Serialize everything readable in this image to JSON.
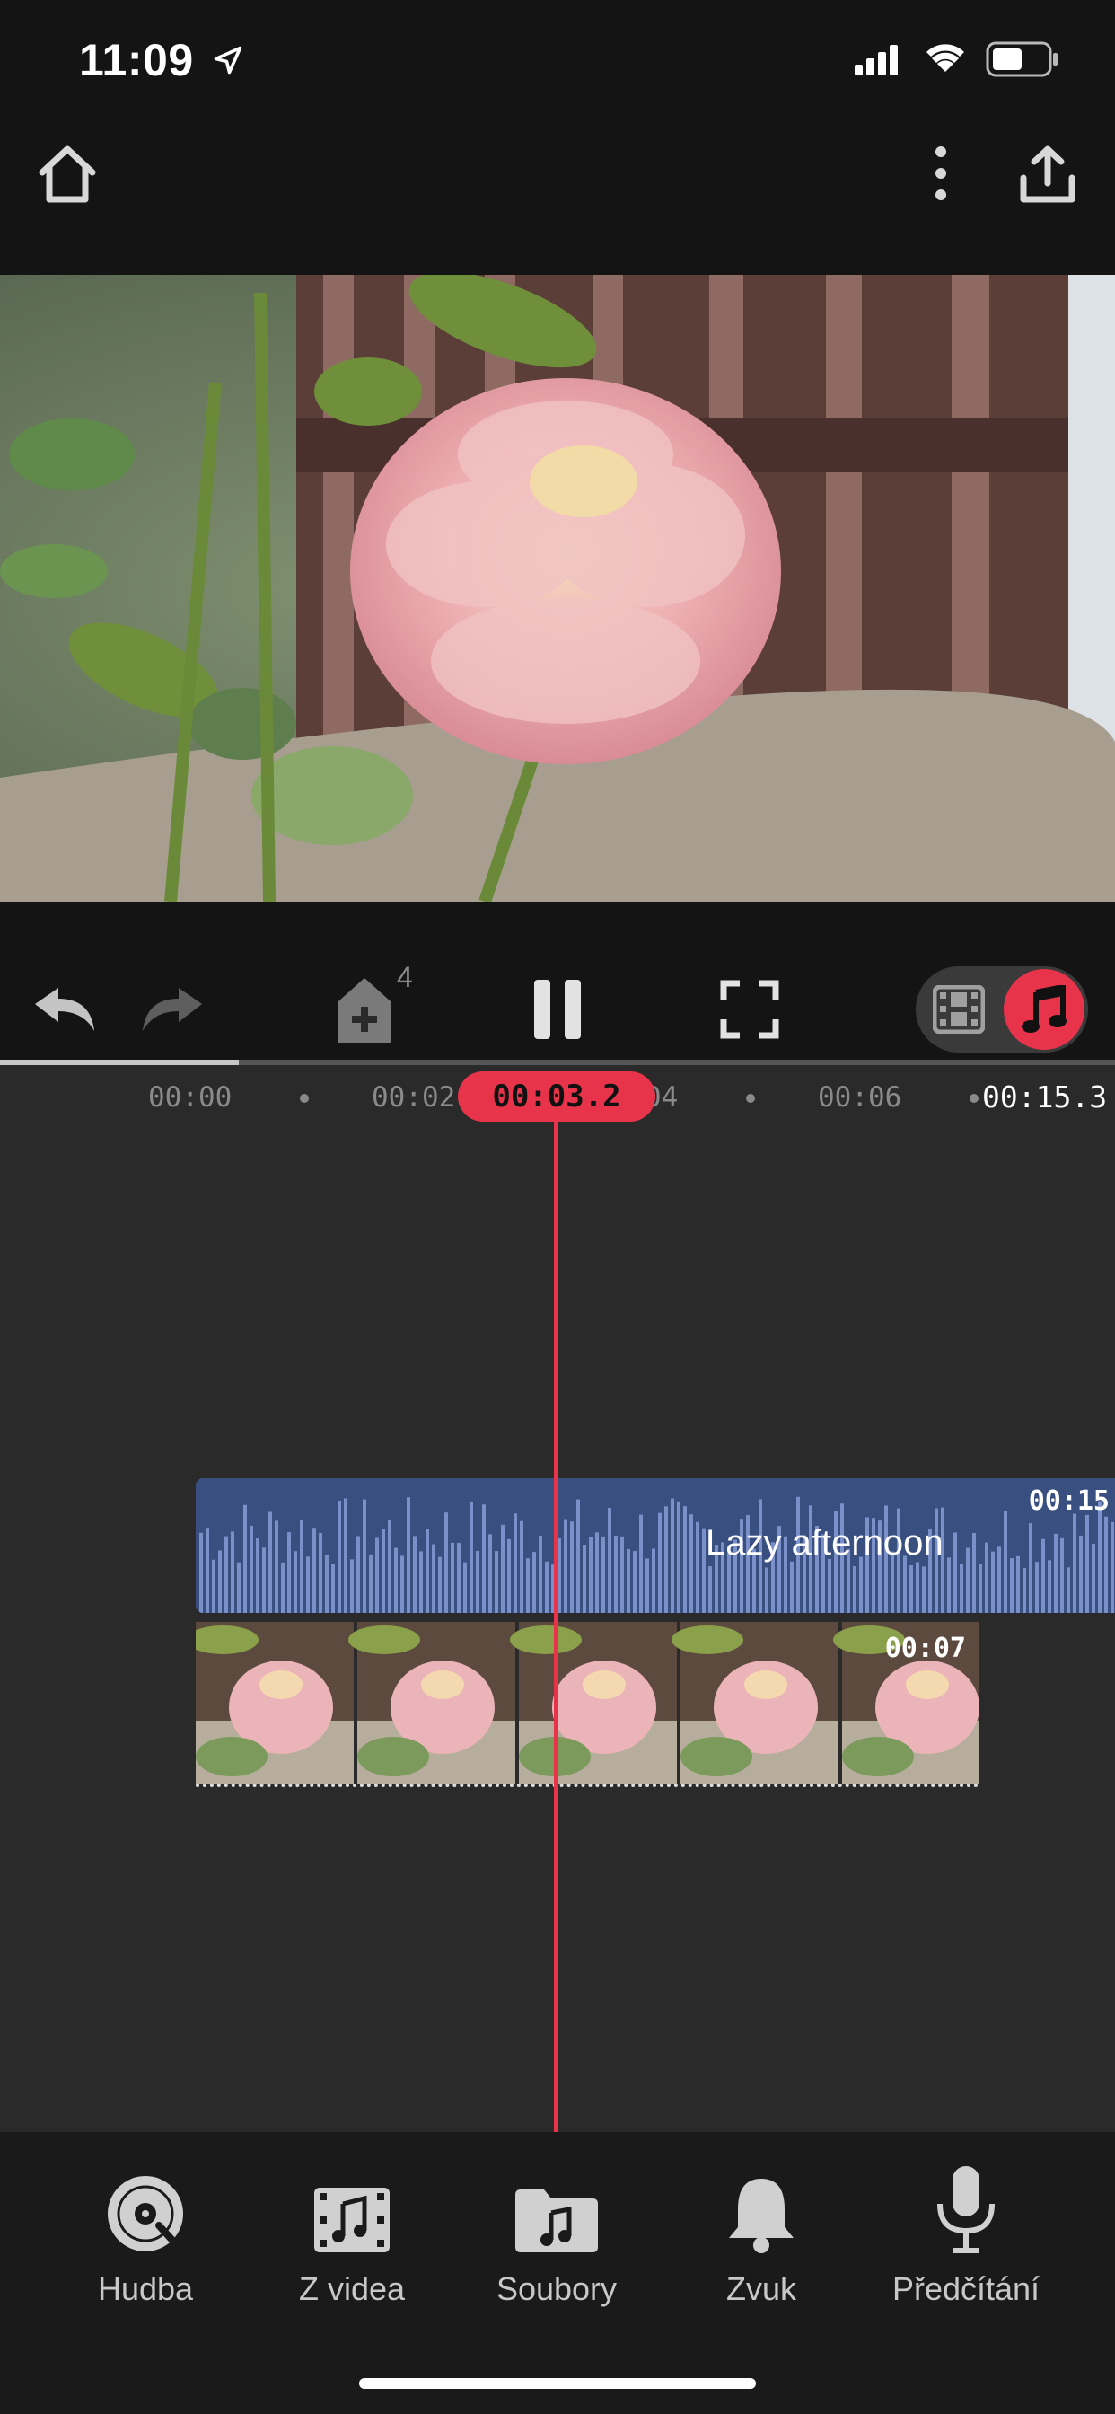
{
  "status": {
    "time": "11:09"
  },
  "toolbar": {
    "undo_count_badge": "4"
  },
  "timeline": {
    "ruler": [
      "00:00",
      "00:02",
      "00:04",
      "00:06"
    ],
    "current_time": "00:03.2",
    "total_duration": "00:15.3",
    "audio_clip": {
      "title": "Lazy afternoon",
      "duration": "00:15"
    },
    "video_clip": {
      "duration": "00:07"
    }
  },
  "bottom_nav": [
    {
      "label": "Hudba",
      "icon": "vinyl-record-icon"
    },
    {
      "label": "Z videa",
      "icon": "film-music-icon"
    },
    {
      "label": "Soubory",
      "icon": "folder-music-icon"
    },
    {
      "label": "Zvuk",
      "icon": "bell-icon"
    },
    {
      "label": "Předčítání",
      "icon": "microphone-icon"
    }
  ],
  "colors": {
    "accent": "#e8344b",
    "audio_track": "#7b8fc8",
    "background": "#2a2a2b"
  }
}
